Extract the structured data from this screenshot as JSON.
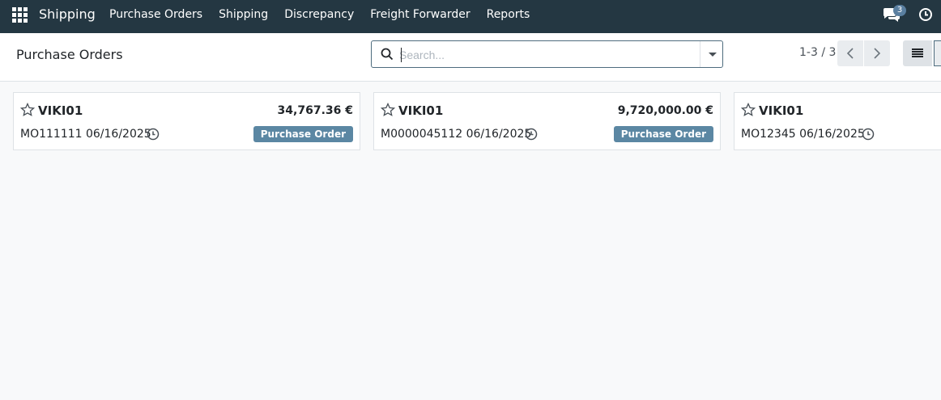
{
  "navbar": {
    "app_name": "Shipping",
    "menu": [
      "Purchase Orders",
      "Shipping",
      "Discrepancy",
      "Freight Forwarder",
      "Reports"
    ],
    "chat_count": "3",
    "icons": [
      "apps-grid-icon",
      "chat-icon",
      "clock-icon"
    ]
  },
  "control_panel": {
    "title": "Purchase Orders",
    "search_placeholder": "Search...",
    "pager": "1-3 / 3"
  },
  "cards": [
    {
      "partner": "VIKI01",
      "amount": "34,767.36 €",
      "ref": "MO111111 06/16/2025",
      "badge": "Purchase Order"
    },
    {
      "partner": "VIKI01",
      "amount": "9,720,000.00 €",
      "ref": "M0000045112 06/16/2025",
      "badge": "Purchase Order"
    },
    {
      "partner": "VIKI01",
      "amount": "",
      "ref": "MO12345 06/16/2025",
      "badge": ""
    }
  ],
  "colors": {
    "navbar_bg": "#243742",
    "badge_bg": "#5b87a3",
    "search_border": "#4e6c7e"
  }
}
